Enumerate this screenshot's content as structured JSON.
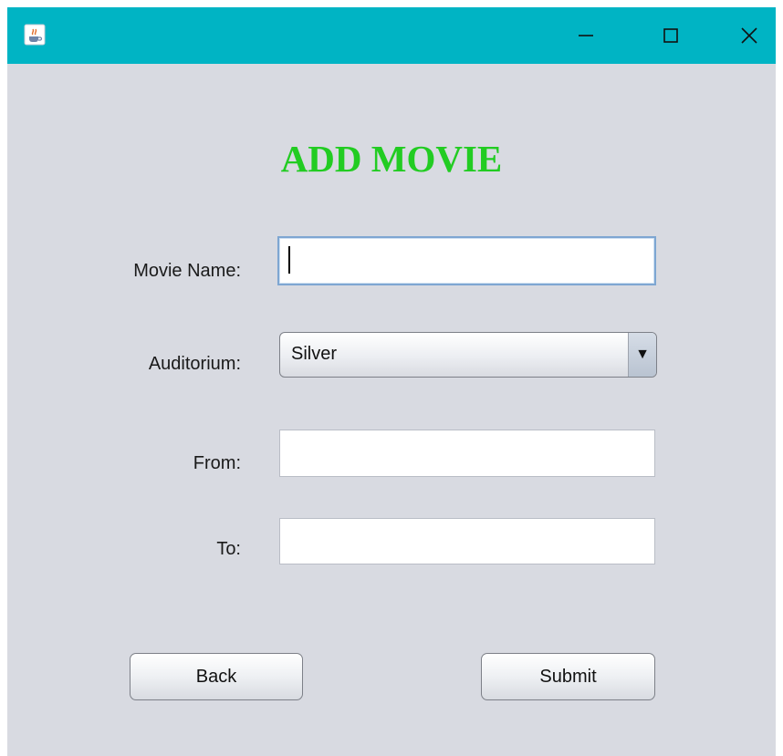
{
  "window": {
    "app_icon": "java-cup-icon",
    "controls": {
      "minimize_icon": "minimize-icon",
      "maximize_icon": "maximize-icon",
      "close_icon": "close-icon"
    },
    "titlebar_color": "#00b4c4"
  },
  "form": {
    "title": "ADD MOVIE",
    "title_color": "#22cc22",
    "movie_name": {
      "label": "Movie Name:",
      "value": ""
    },
    "auditorium": {
      "label": "Auditorium:",
      "selected": "Silver",
      "arrow_icon": "dropdown-arrow-icon"
    },
    "from": {
      "label": "From:",
      "value": ""
    },
    "to": {
      "label": "To:",
      "value": ""
    }
  },
  "buttons": {
    "back": "Back",
    "submit": "Submit"
  }
}
